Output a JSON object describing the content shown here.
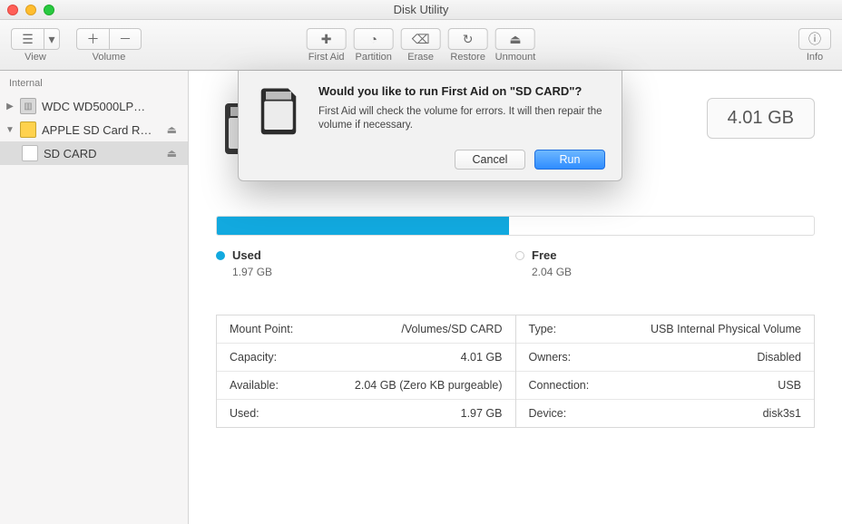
{
  "window": {
    "title": "Disk Utility"
  },
  "toolbar": {
    "view_label": "View",
    "volume_label": "Volume",
    "first_aid_label": "First Aid",
    "partition_label": "Partition",
    "erase_label": "Erase",
    "restore_label": "Restore",
    "unmount_label": "Unmount",
    "info_label": "Info"
  },
  "sidebar": {
    "section": "Internal",
    "items": [
      {
        "label": "WDC WD5000LP…",
        "disclosure": "▶",
        "eject": false
      },
      {
        "label": "APPLE SD Card R…",
        "disclosure": "▼",
        "eject": true
      },
      {
        "label": "SD CARD",
        "eject": true
      }
    ]
  },
  "header": {
    "size": "4.01 GB"
  },
  "usage": {
    "used_label": "Used",
    "used_value": "1.97 GB",
    "free_label": "Free",
    "free_value": "2.04 GB",
    "used_pct": 49
  },
  "info_left": [
    {
      "k": "Mount Point:",
      "v": "/Volumes/SD CARD"
    },
    {
      "k": "Capacity:",
      "v": "4.01 GB"
    },
    {
      "k": "Available:",
      "v": "2.04 GB (Zero KB purgeable)"
    },
    {
      "k": "Used:",
      "v": "1.97 GB"
    }
  ],
  "info_right": [
    {
      "k": "Type:",
      "v": "USB Internal Physical Volume"
    },
    {
      "k": "Owners:",
      "v": "Disabled"
    },
    {
      "k": "Connection:",
      "v": "USB"
    },
    {
      "k": "Device:",
      "v": "disk3s1"
    }
  ],
  "dialog": {
    "title": "Would you like to run First Aid on \"SD CARD\"?",
    "message": "First Aid will check the volume for errors. It will then repair the volume if necessary.",
    "cancel_label": "Cancel",
    "run_label": "Run"
  }
}
